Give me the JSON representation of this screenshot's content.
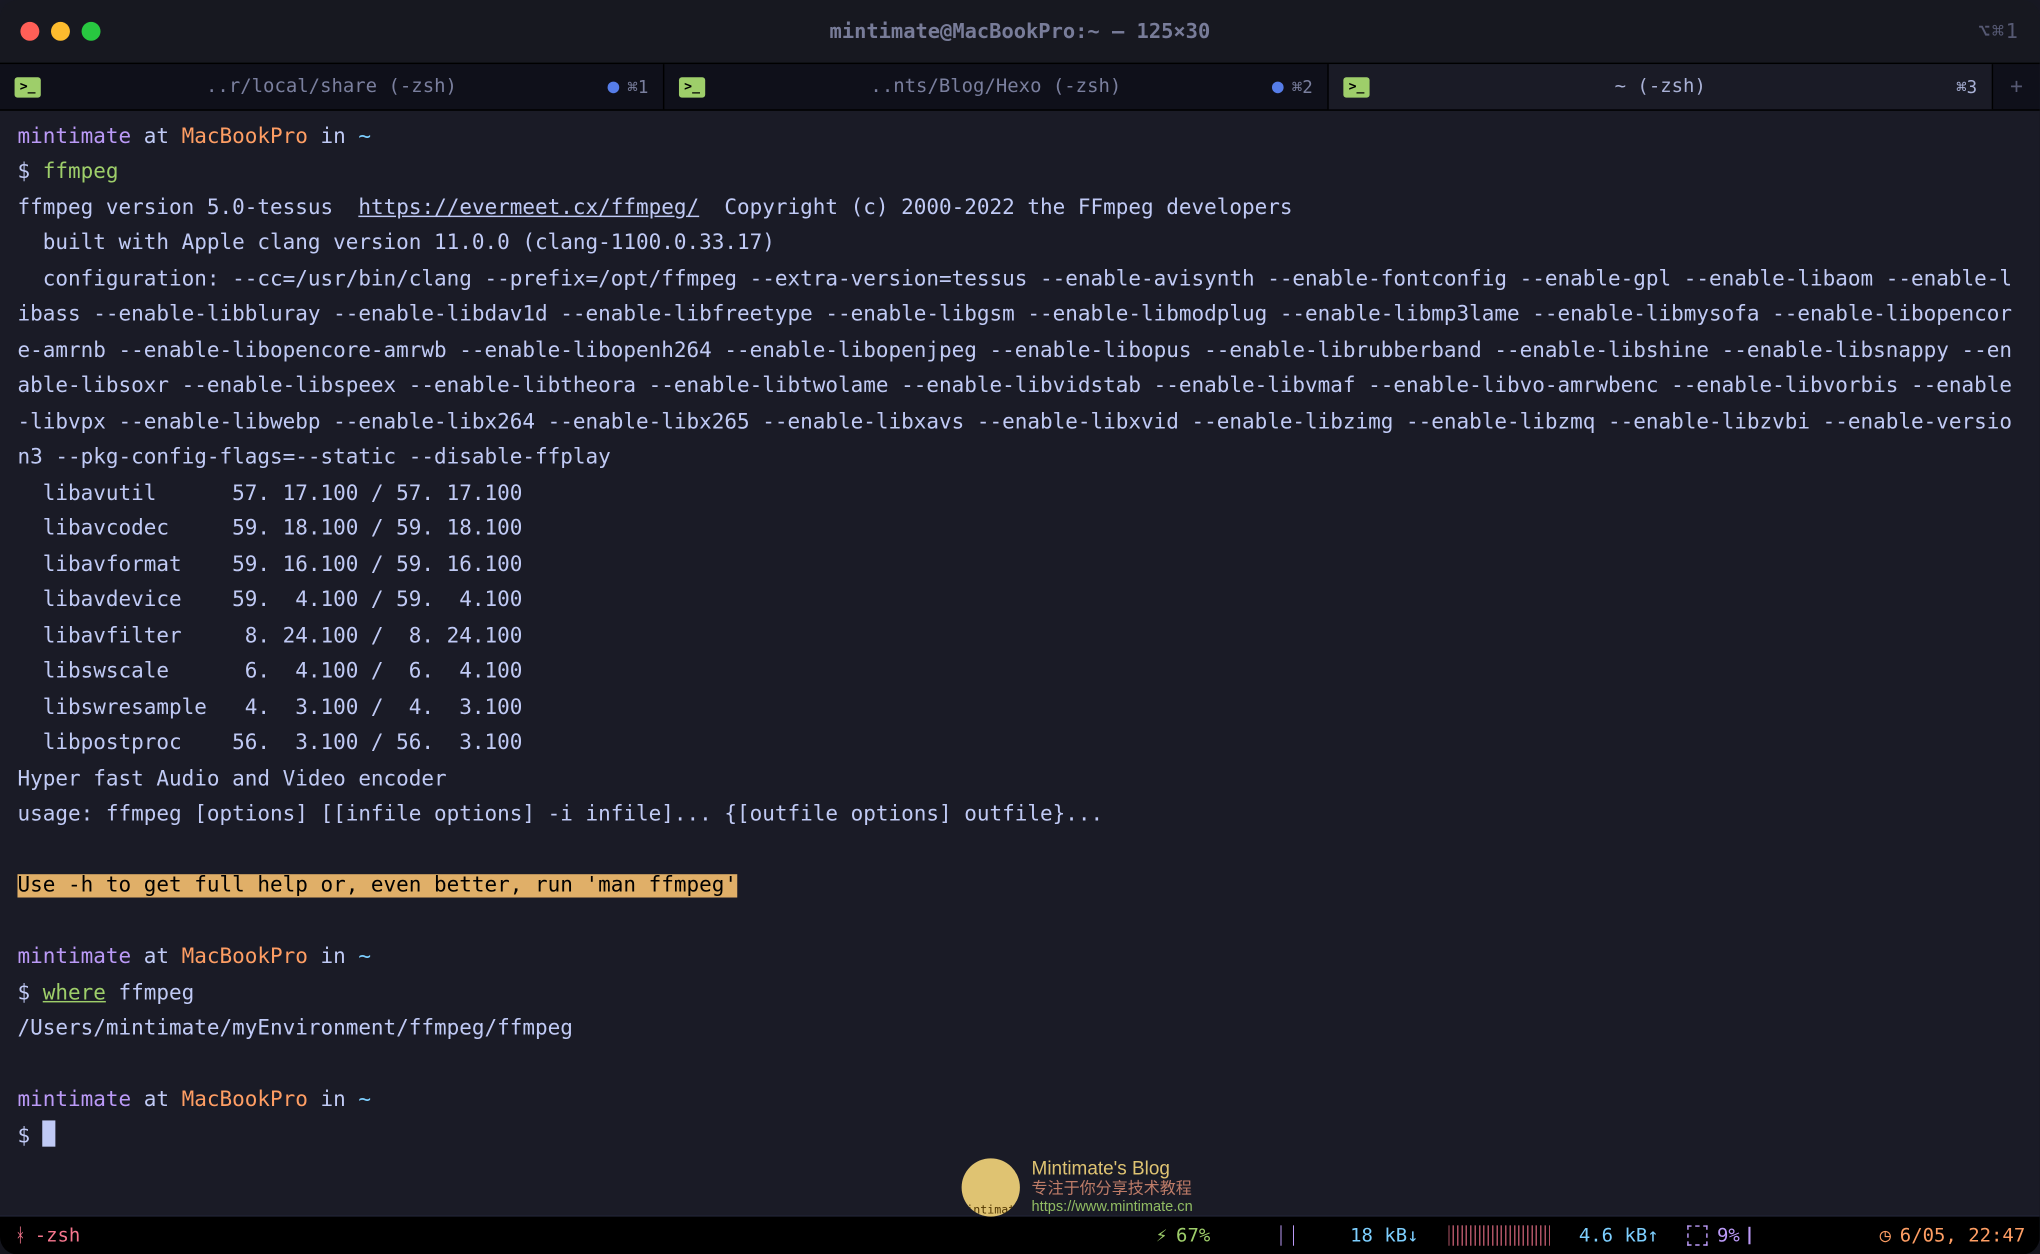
{
  "window": {
    "title": "mintimate@MacBookPro:~ — 125×30",
    "title_right_glyph": "⌥⌘1"
  },
  "tabs": [
    {
      "icon": ">_",
      "label": "..r/local/share (-zsh)",
      "shortcut": "⌘1",
      "dirty": true,
      "active": false
    },
    {
      "icon": ">_",
      "label": "..nts/Blog/Hexo (-zsh)",
      "shortcut": "⌘2",
      "dirty": true,
      "active": false
    },
    {
      "icon": ">_",
      "label": "~ (-zsh)",
      "shortcut": "⌘3",
      "dirty": false,
      "active": true
    }
  ],
  "prompt": {
    "user": "mintimate",
    "at": " at ",
    "host": "MacBookPro",
    "in": " in ",
    "path": "~",
    "symbol": "$ "
  },
  "commands": {
    "cmd1": "ffmpeg",
    "cmd2a": "where",
    "cmd2b": " ffmpeg"
  },
  "output": {
    "line1a": "ffmpeg version 5.0-tessus  ",
    "line1b": "https://evermeet.cx/ffmpeg/",
    "line1c": "  Copyright (c) 2000-2022 the FFmpeg developers",
    "line2": "  built with Apple clang version 11.0.0 (clang-1100.0.33.17)",
    "line3": "  configuration: --cc=/usr/bin/clang --prefix=/opt/ffmpeg --extra-version=tessus --enable-avisynth --enable-fontconfig --enable-gpl --enable-libaom --enable-libass --enable-libbluray --enable-libdav1d --enable-libfreetype --enable-libgsm --enable-libmodplug --enable-libmp3lame --enable-libmysofa --enable-libopencore-amrnb --enable-libopencore-amrwb --enable-libopenh264 --enable-libopenjpeg --enable-libopus --enable-librubberband --enable-libshine --enable-libsnappy --enable-libsoxr --enable-libspeex --enable-libtheora --enable-libtwolame --enable-libvidstab --enable-libvmaf --enable-libvo-amrwbenc --enable-libvorbis --enable-libvpx --enable-libwebp --enable-libx264 --enable-libx265 --enable-libxavs --enable-libxvid --enable-libzimg --enable-libzmq --enable-libzvbi --enable-version3 --pkg-config-flags=--static --disable-ffplay",
    "libs": [
      "  libavutil      57. 17.100 / 57. 17.100",
      "  libavcodec     59. 18.100 / 59. 18.100",
      "  libavformat    59. 16.100 / 59. 16.100",
      "  libavdevice    59.  4.100 / 59.  4.100",
      "  libavfilter     8. 24.100 /  8. 24.100",
      "  libswscale      6.  4.100 /  6.  4.100",
      "  libswresample   4.  3.100 /  4.  3.100",
      "  libpostproc    56.  3.100 / 56.  3.100"
    ],
    "hyper": "Hyper fast Audio and Video encoder",
    "usage": "usage: ffmpeg [options] [[infile options] -i infile]... {[outfile options] outfile}...",
    "hint": "Use -h to get full help or, even better, run 'man ffmpeg'",
    "where_out": "/Users/mintimate/myEnvironment/ffmpeg/ffmpeg"
  },
  "statusbar": {
    "left_glyph": "ᚼ",
    "process": "-zsh",
    "battery_glyph": "⚡",
    "battery": "67%",
    "net_down": "18 kB↓",
    "net_up": "4.6 kB↑",
    "cpu_glyph": "▦",
    "cpu": "9%",
    "clock_glyph": "◷",
    "datetime": "6/05, 22:47"
  },
  "watermark": {
    "title": "Mintimate's Blog",
    "subtitle": "专注于你分享技术教程",
    "url": "https://www.mintimate.cn"
  }
}
